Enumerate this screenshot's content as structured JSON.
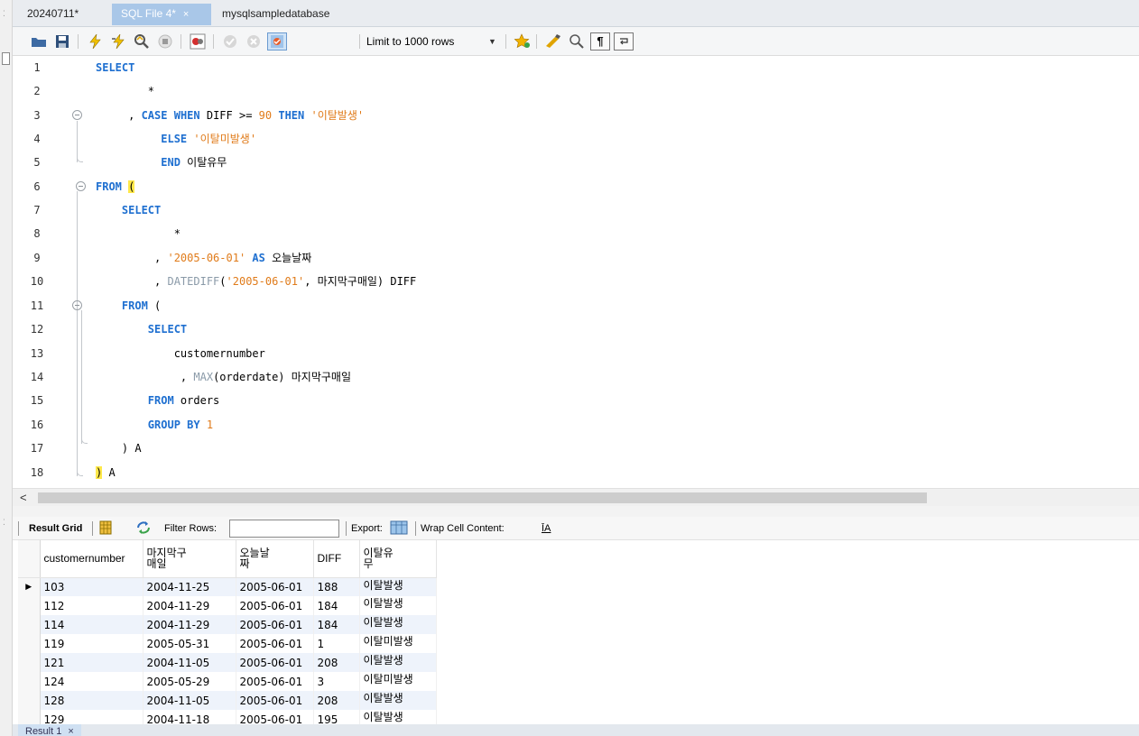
{
  "tabs": [
    {
      "label": "20240711*",
      "active": false
    },
    {
      "label": "SQL File 4*",
      "active": true
    },
    {
      "label": "mysqlsampledatabase",
      "active": false
    }
  ],
  "tab_close": "×",
  "toolbar": {
    "limit_label": "Limit to 1000 rows",
    "icons": [
      "open-folder-icon",
      "save-icon",
      "execute-icon",
      "execute-current-icon",
      "explain-icon",
      "stop-icon",
      "toggle-error-icon",
      "commit-icon",
      "rollback-icon",
      "autocommit-icon",
      "bookmark-star-icon",
      "beautify-icon",
      "find-icon",
      "invisible-chars-icon",
      "wrap-icon"
    ]
  },
  "editor": {
    "line_numbers": [
      "1",
      "2",
      "3",
      "4",
      "5",
      "6",
      "7",
      "8",
      "9",
      "10",
      "11",
      "12",
      "13",
      "14",
      "15",
      "16",
      "17",
      "18"
    ]
  },
  "scroll_left": "<",
  "result_toolbar": {
    "result_grid_label": "Result Grid",
    "filter_rows_label": "Filter Rows:",
    "filter_value": "",
    "export_label": "Export:",
    "wrap_label": "Wrap Cell Content:",
    "wrap_icon_glyph": "ĪA"
  },
  "grid": {
    "columns": [
      "customernumber",
      "마지막구 매일",
      "오늘날 짜",
      "DIFF",
      "이탈유 무"
    ],
    "column_lines": [
      [
        "customernumber"
      ],
      [
        "마지막구",
        "매일"
      ],
      [
        "오늘날",
        "짜"
      ],
      [
        "DIFF"
      ],
      [
        "이탈유",
        "무"
      ]
    ],
    "current_row_marker": "▶",
    "rows": [
      [
        "103",
        "2004-11-25",
        "2005-06-01",
        "188",
        "이탈발생"
      ],
      [
        "112",
        "2004-11-29",
        "2005-06-01",
        "184",
        "이탈발생"
      ],
      [
        "114",
        "2004-11-29",
        "2005-06-01",
        "184",
        "이탈발생"
      ],
      [
        "119",
        "2005-05-31",
        "2005-06-01",
        "1",
        "이탈미발생"
      ],
      [
        "121",
        "2004-11-05",
        "2005-06-01",
        "208",
        "이탈발생"
      ],
      [
        "124",
        "2005-05-29",
        "2005-06-01",
        "3",
        "이탈미발생"
      ],
      [
        "128",
        "2004-11-05",
        "2005-06-01",
        "208",
        "이탈발생"
      ],
      [
        "129",
        "2004-11-18",
        "2005-06-01",
        "195",
        "이탈발생"
      ]
    ]
  },
  "bottom_tab": {
    "label": "Result 1",
    "close": "×"
  },
  "sql": {
    "l1_select": "SELECT",
    "l2_star": "*",
    "l3_comma": ", ",
    "l3_case": "CASE",
    "l3_when": "WHEN",
    "l3_diff": " DIFF >= ",
    "l3_num": "90",
    "l3_then": "THEN",
    "l3_str": "'이탈발생'",
    "l4_else": "ELSE",
    "l4_str": "'이탈미발생'",
    "l5_end": "END",
    "l5_alias": " 이탈유무",
    "l6_from": "FROM",
    "l6_paren": "(",
    "l7_select": "SELECT",
    "l8_star": "*",
    "l9_comma": ", ",
    "l9_str": "'2005-06-01'",
    "l9_as": "AS",
    "l9_alias": " 오늘날짜",
    "l10_comma": ", ",
    "l10_fn": "DATEDIFF",
    "l10_open": "(",
    "l10_str": "'2005-06-01'",
    "l10_rest": ", 마지막구매일) DIFF",
    "l11_from": "FROM",
    "l11_paren": " (",
    "l12_select": "SELECT",
    "l13_col": "customernumber",
    "l14_comma": ", ",
    "l14_fn": "MAX",
    "l14_rest": "(orderdate) 마지막구매일",
    "l15_from": "FROM",
    "l15_table": " orders",
    "l16_group": "GROUP BY",
    "l16_num": "1",
    "l17_close": ") A",
    "l18_paren": ")",
    "l18_alias": " A"
  }
}
